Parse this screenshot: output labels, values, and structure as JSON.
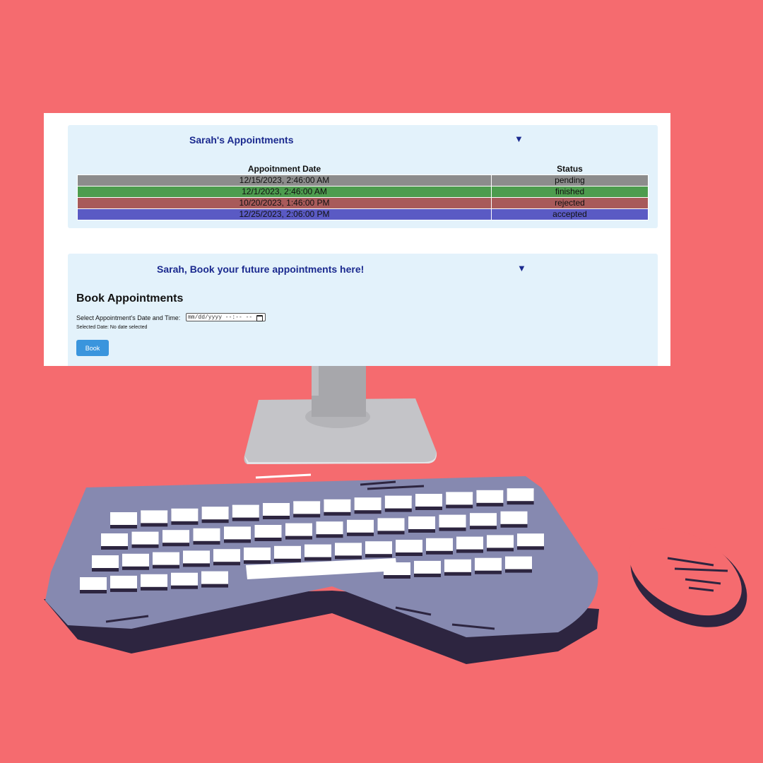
{
  "appointments_panel": {
    "title": "Sarah's Appointments",
    "toggle": "▼",
    "columns": [
      "Appoitnment Date",
      "Status"
    ],
    "rows": [
      {
        "date": "12/15/2023, 2:46:00 AM",
        "status": "pending",
        "color": "#8c8c8c"
      },
      {
        "date": "12/1/2023, 2:46:00 AM",
        "status": "finished",
        "color": "#4d9c4e"
      },
      {
        "date": "10/20/2023, 1:46:00 PM",
        "status": "rejected",
        "color": "#a85a5a"
      },
      {
        "date": "12/25/2023, 2:06:00 PM",
        "status": "accepted",
        "color": "#5a5ac4"
      }
    ]
  },
  "booking_panel": {
    "title": "Sarah, Book your future appointments here!",
    "toggle": "▼",
    "heading": "Book Appointments",
    "datetime_label": "Select Appointment's Date and Time:",
    "datetime_placeholder": "mm/dd/yyyy --:-- --",
    "selected_date_text": "Selected Date: No date selected",
    "book_button": "Book"
  },
  "colors": {
    "background": "#f56b6f",
    "panel_bg": "#e3f2fb",
    "title_text": "#1b2a8f",
    "button": "#3a95dd",
    "keyboard": "#8689b0",
    "keyboard_shadow": "#2d2540",
    "keys": "#ffffff",
    "stand": "#c4c4c8"
  }
}
